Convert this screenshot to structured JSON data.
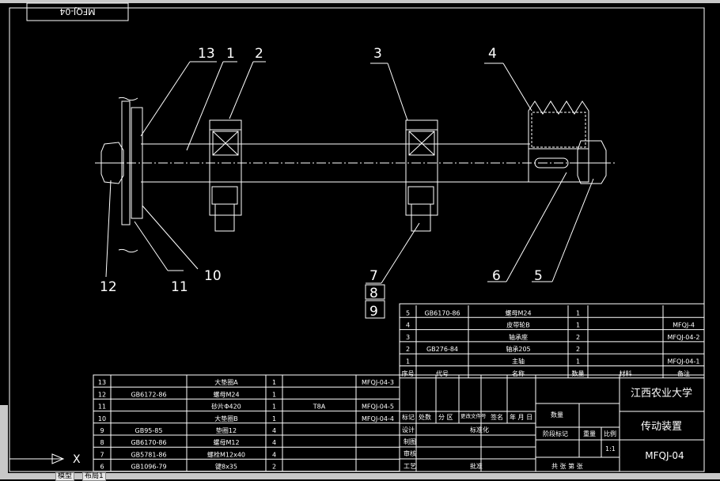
{
  "drawing": {
    "frame_label": "MFQJ-04",
    "balloons": [
      "13",
      "1",
      "2",
      "3",
      "4",
      "12",
      "11",
      "10",
      "7",
      "8",
      "9",
      "6",
      "5"
    ]
  },
  "parts_upper": {
    "headers": [
      "序号",
      "代号",
      "名称",
      "数量",
      "材料",
      "备注"
    ],
    "rows": [
      [
        "5",
        "GB6170-86",
        "螺母M24",
        "1",
        "",
        ""
      ],
      [
        "4",
        "",
        "皮带轮B",
        "1",
        "",
        "MFQJ-4"
      ],
      [
        "3",
        "",
        "轴承座",
        "2",
        "",
        "MFQJ-04-2"
      ],
      [
        "2",
        "GB276-84",
        "轴承205",
        "2",
        "",
        ""
      ],
      [
        "1",
        "",
        "主轴",
        "1",
        "",
        "MFQJ-04-1"
      ]
    ]
  },
  "parts_lower": {
    "rows": [
      [
        "13",
        "",
        "大垫圈A",
        "1",
        "",
        "MFQJ-04-3"
      ],
      [
        "12",
        "GB6172-86",
        "螺母M24",
        "1",
        "",
        ""
      ],
      [
        "11",
        "",
        "砂片Φ420",
        "1",
        "T8A",
        "MFQJ-04-5"
      ],
      [
        "10",
        "",
        "大垫圈B",
        "1",
        "",
        "MFQJ-04-4"
      ],
      [
        "9",
        "GB95-85",
        "垫圈12",
        "4",
        "",
        ""
      ],
      [
        "8",
        "GB6170-86",
        "螺母M12",
        "4",
        "",
        ""
      ],
      [
        "7",
        "GB5781-86",
        "螺栓M12x40",
        "4",
        "",
        ""
      ],
      [
        "6",
        "GB1096-79",
        "键8x35",
        "2",
        "",
        ""
      ]
    ]
  },
  "title_block": {
    "school": "江西农业大学",
    "drawing_name": "传动装置",
    "drawing_no": "MFQJ-04",
    "scale": "1:1",
    "labels": {
      "mark": "标记",
      "count": "处数",
      "zone": "分 区",
      "change_doc": "更改文件号",
      "sign": "签名",
      "date": "年 月 日",
      "design": "设计",
      "std": "标准化",
      "check": "制图",
      "audit": "审核",
      "process": "工艺",
      "approve": "批准",
      "qty": "数量",
      "stage": "阶段标记",
      "weight": "重量",
      "ratio": "比例",
      "sheets": "共 张 第 张"
    }
  },
  "tabs": [
    "模型",
    "布局1"
  ],
  "colors": {
    "bg": "#000000",
    "line": "#ffffff",
    "ui": "#c8c8c8"
  }
}
